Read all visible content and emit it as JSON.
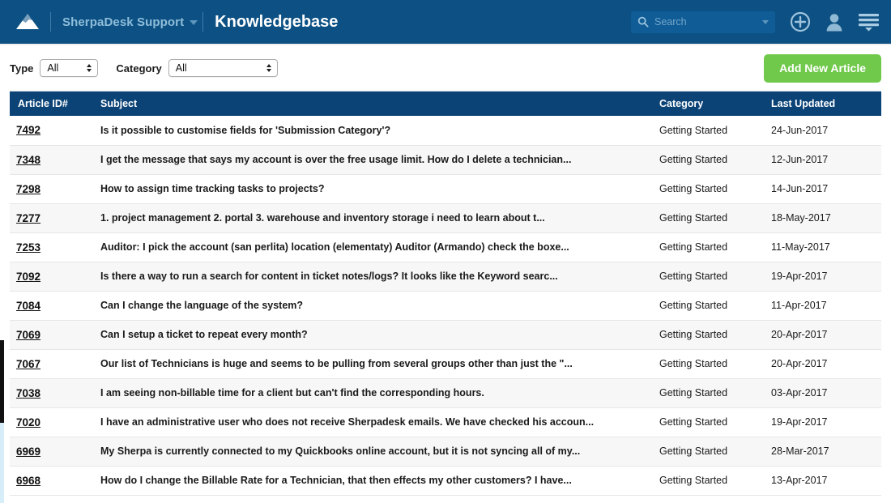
{
  "header": {
    "logo_name": "sherpadesk-mountain-logo",
    "brand": "SherpaDesk Support",
    "page_title": "Knowledgebase",
    "search": {
      "placeholder": "Search",
      "value": ""
    },
    "icons": {
      "add": "plus-circle-icon",
      "user": "user-icon",
      "menu": "hamburger-menu-icon"
    },
    "colors": {
      "bar": "#0d5184",
      "brand_text": "#8ebdd9",
      "search_field": "#0f5c97"
    }
  },
  "filters": {
    "type_label": "Type",
    "type_value": "All",
    "category_label": "Category",
    "category_value": "All",
    "add_button_label": "Add New Article",
    "add_button_color": "#70c94a"
  },
  "table": {
    "header_color": "#0b4377",
    "columns": [
      "Article ID#",
      "Subject",
      "Category",
      "Last Updated"
    ],
    "rows": [
      {
        "id": "7492",
        "subject": "Is it possible to customise fields for 'Submission Category'?",
        "category": "Getting Started",
        "updated": "24-Jun-2017"
      },
      {
        "id": "7348",
        "subject": "I get the message that says my account is over the free usage limit. How do I delete a technician...",
        "category": "Getting Started",
        "updated": "12-Jun-2017"
      },
      {
        "id": "7298",
        "subject": "How to assign time tracking tasks to projects?",
        "category": "Getting Started",
        "updated": "14-Jun-2017"
      },
      {
        "id": "7277",
        "subject": "1. project management 2. portal 3. warehouse and inventory storage i need to learn about t...",
        "category": "Getting Started",
        "updated": "18-May-2017"
      },
      {
        "id": "7253",
        "subject": "Auditor: I pick the account (san perlita) location (elementaty) Auditor (Armando) check the boxe...",
        "category": "Getting Started",
        "updated": "11-May-2017"
      },
      {
        "id": "7092",
        "subject": "Is there a way to run a search for content in ticket notes/logs? It looks like the Keyword searc...",
        "category": "Getting Started",
        "updated": "19-Apr-2017"
      },
      {
        "id": "7084",
        "subject": "Can I change the language of the system?",
        "category": "Getting Started",
        "updated": "11-Apr-2017"
      },
      {
        "id": "7069",
        "subject": "Can I setup a ticket to repeat every month?",
        "category": "Getting Started",
        "updated": "20-Apr-2017"
      },
      {
        "id": "7067",
        "subject": "Our list of Technicians is huge and seems to be pulling from several groups other than just the \"...",
        "category": "Getting Started",
        "updated": "20-Apr-2017"
      },
      {
        "id": "7038",
        "subject": "I am seeing non-billable time for a client but can't find the corresponding hours.",
        "category": "Getting Started",
        "updated": "03-Apr-2017"
      },
      {
        "id": "7020",
        "subject": "I have an administrative user who does not receive Sherpadesk emails. We have checked his accoun...",
        "category": "Getting Started",
        "updated": "19-Apr-2017"
      },
      {
        "id": "6969",
        "subject": "My Sherpa is currently connected to my Quickbooks online account, but it is not syncing all of my...",
        "category": "Getting Started",
        "updated": "28-Mar-2017"
      },
      {
        "id": "6968",
        "subject": "How do I change the Billable Rate for a Technician, that then effects my other customers? I have...",
        "category": "Getting Started",
        "updated": "13-Apr-2017"
      }
    ]
  }
}
